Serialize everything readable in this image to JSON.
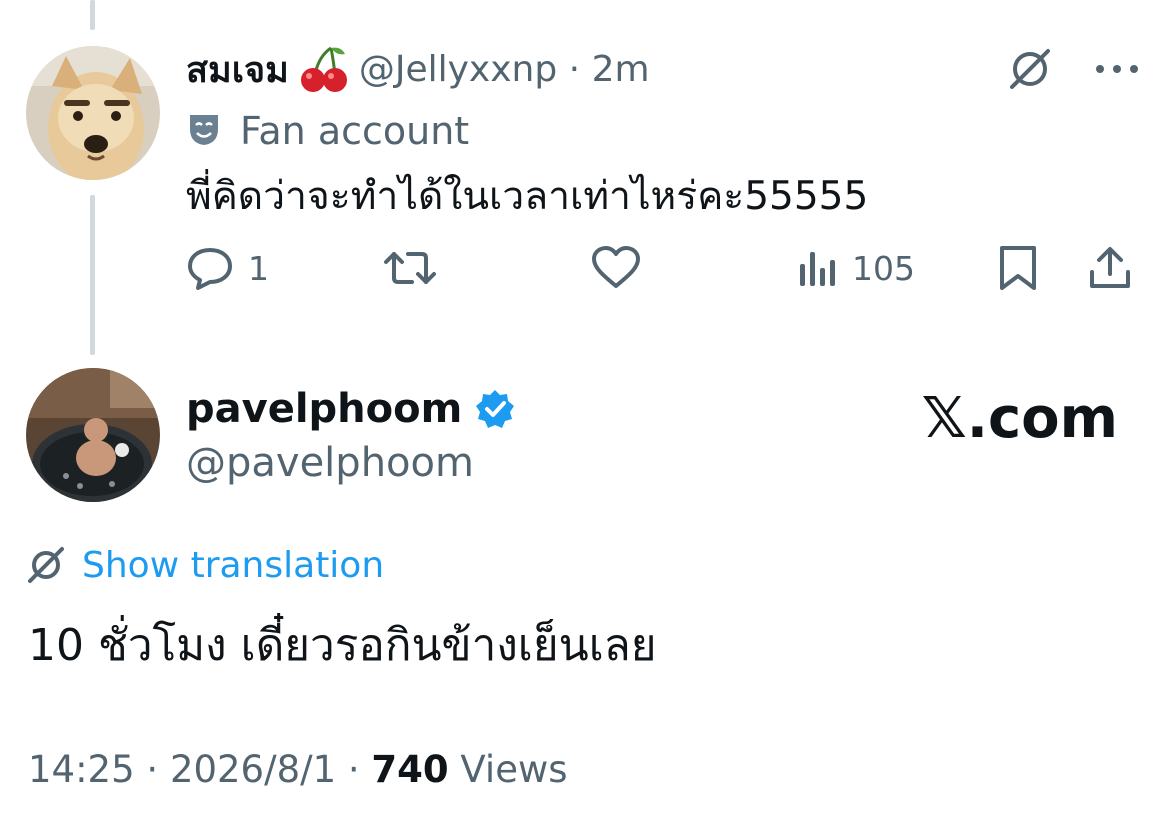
{
  "reply": {
    "display_name": "สมเจม",
    "emoji": "cherries",
    "handle": "@Jellyxxnp",
    "separator": "·",
    "time": "2m",
    "badge_label": "Fan account",
    "text": "พี่คิดว่าจะทำได้ในเวลาเท่าไหร่คะ55555",
    "actions": {
      "reply_count": "1",
      "retweet_count": "",
      "like_count": "",
      "views_count": "105"
    },
    "icons": [
      "translate-icon",
      "more-icon",
      "reply-icon",
      "retweet-icon",
      "like-icon",
      "views-icon",
      "bookmark-icon",
      "share-icon"
    ]
  },
  "main": {
    "display_name": "pavelphoom",
    "handle": "@pavelphoom",
    "verified": true,
    "brand": "𝕏.com",
    "translation_label": "Show translation",
    "text": "10 ชั่วโมง เดี๋ยวรอกินข้างเย็นเลย",
    "time": "14:25",
    "date": "2026/8/1",
    "views": "740",
    "views_label": "Views",
    "separator": "·"
  },
  "colors": {
    "accent": "#1d9bf0",
    "secondary_text": "#536471",
    "primary_text": "#0f1419",
    "thread_line": "#cfd9de"
  }
}
